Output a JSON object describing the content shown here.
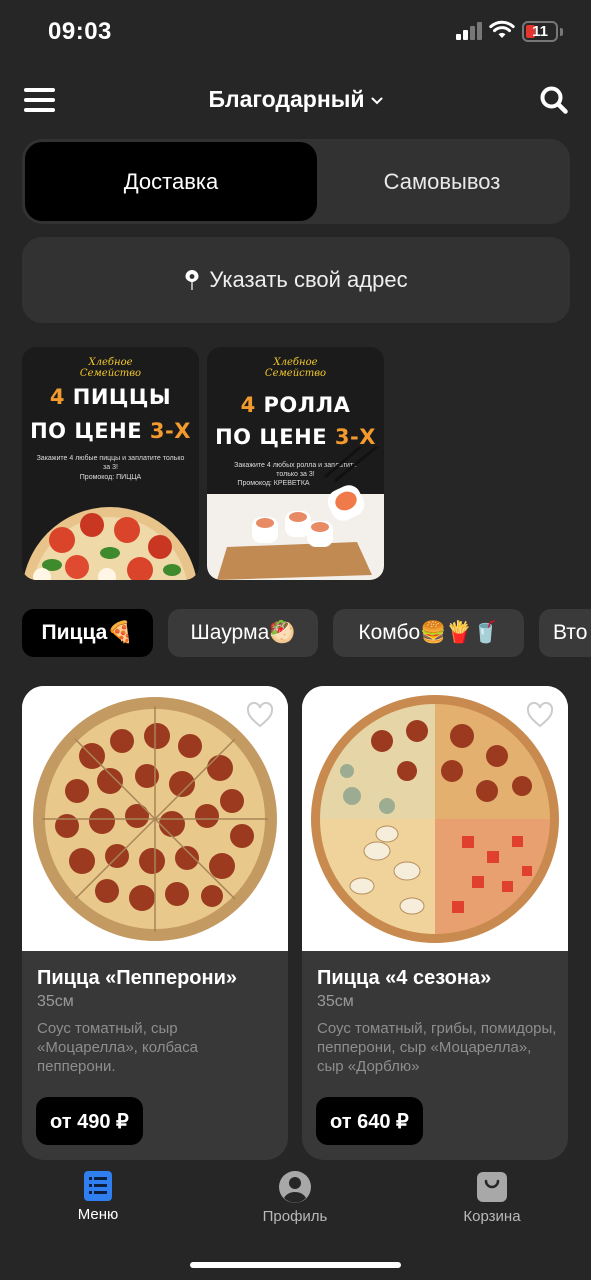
{
  "status_bar": {
    "time": "09:03",
    "battery": "11"
  },
  "header": {
    "city": "Благодарный"
  },
  "delivery_mode": {
    "options": [
      "Доставка",
      "Самовывоз"
    ],
    "selected": "Доставка"
  },
  "address": {
    "label": "Указать свой адрес"
  },
  "promos": [
    {
      "brand_line1": "Хлебное",
      "brand_line2": "Семейство",
      "count": "4",
      "title_a": "ПИЦЦЫ",
      "title_b": "ПО ЦЕНЕ",
      "title_c": "3-Х",
      "note": "Закажите 4 любые пиццы и заплатите только за 3!",
      "promo": "Промокод: ПИЦЦА"
    },
    {
      "brand_line1": "Хлебное",
      "brand_line2": "Семейство",
      "count": "4",
      "title_a": "РОЛЛА",
      "title_b": "ПО ЦЕНЕ",
      "title_c": "3-Х",
      "note": "Закажите 4 любых ролла и заплатите только за 3!",
      "promo": "Промокод: КРЕВЕТКА"
    }
  ],
  "categories": [
    {
      "label": "Пицца🍕"
    },
    {
      "label": "Шаурма🥙"
    },
    {
      "label": "Комбо🍔🍟🥤"
    },
    {
      "label": "Вто"
    }
  ],
  "products": [
    {
      "name": "Пицца «Пепперони»",
      "size": "35см",
      "description": "Соус томатный, сыр «Моцарелла», колбаса пепперони.",
      "price": "от 490 ₽"
    },
    {
      "name": "Пицца «4 сезона»",
      "size": "35см",
      "description": "Соус томатный, грибы, помидоры, пепперони, сыр «Моцарелла», сыр «Дорблю»",
      "price": "от 640 ₽"
    }
  ],
  "tabbar": [
    {
      "label": "Меню",
      "icon": "menu-list-icon"
    },
    {
      "label": "Профиль",
      "icon": "profile-icon"
    },
    {
      "label": "Корзина",
      "icon": "cart-icon"
    }
  ],
  "colors": {
    "background": "#262626",
    "surface": "#323232",
    "accent_tab": "#2f7ff0",
    "promo_orange": "#f29a2e",
    "brand_yellow": "#f2c72b"
  }
}
